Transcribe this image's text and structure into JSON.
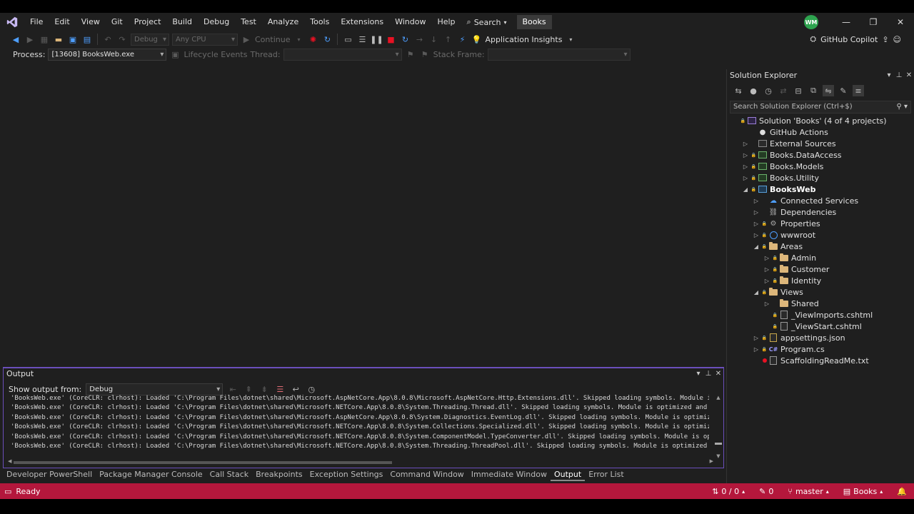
{
  "menubar": {
    "items": [
      "File",
      "Edit",
      "View",
      "Git",
      "Project",
      "Build",
      "Debug",
      "Test",
      "Analyze",
      "Tools",
      "Extensions",
      "Window",
      "Help"
    ],
    "search_label": "Search",
    "solution_name": "Books",
    "avatar_initials": "WM"
  },
  "toolbar": {
    "config_value": "Debug",
    "platform_value": "Any CPU",
    "continue_label": "Continue",
    "app_insights_label": "Application Insights",
    "github_copilot_label": "GitHub Copilot"
  },
  "toolbar2": {
    "process_label": "Process:",
    "process_value": "[13608] BooksWeb.exe",
    "lifecycle_label": "Lifecycle Events",
    "thread_label": "Thread:",
    "stack_frame_label": "Stack Frame:"
  },
  "output": {
    "title": "Output",
    "show_from_label": "Show output from:",
    "source_value": "Debug",
    "lines": [
      "'BooksWeb.exe' (CoreCLR: clrhost): Loaded 'C:\\Program Files\\dotnet\\shared\\Microsoft.AspNetCore.App\\8.0.8\\Microsoft.AspNetCore.Http.Extensions.dll'. Skipped loading symbols. Module is c",
      "'BooksWeb.exe' (CoreCLR: clrhost): Loaded 'C:\\Program Files\\dotnet\\shared\\Microsoft.NETCore.App\\8.0.8\\System.Threading.Thread.dll'. Skipped loading symbols. Module is optimized and the",
      "'BooksWeb.exe' (CoreCLR: clrhost): Loaded 'C:\\Program Files\\dotnet\\shared\\Microsoft.AspNetCore.App\\8.0.8\\System.Diagnostics.EventLog.dll'. Skipped loading symbols. Module is optimized",
      "'BooksWeb.exe' (CoreCLR: clrhost): Loaded 'C:\\Program Files\\dotnet\\shared\\Microsoft.NETCore.App\\8.0.8\\System.Collections.Specialized.dll'. Skipped loading symbols. Module is optimized",
      "'BooksWeb.exe' (CoreCLR: clrhost): Loaded 'C:\\Program Files\\dotnet\\shared\\Microsoft.NETCore.App\\8.0.8\\System.ComponentModel.TypeConverter.dll'. Skipped loading symbols. Module is optim",
      "'BooksWeb.exe' (CoreCLR: clrhost): Loaded 'C:\\Program Files\\dotnet\\shared\\Microsoft.NETCore.App\\8.0.8\\System.Threading.ThreadPool.dll'. Skipped loading symbols. Module is optimized and"
    ]
  },
  "bottom_tabs": [
    "Developer PowerShell",
    "Package Manager Console",
    "Call Stack",
    "Breakpoints",
    "Exception Settings",
    "Command Window",
    "Immediate Window",
    "Output",
    "Error List"
  ],
  "solution_explorer": {
    "title": "Solution Explorer",
    "search_placeholder": "Search Solution Explorer (Ctrl+$)",
    "tree": [
      {
        "label": "Solution 'Books' (4 of 4 projects)",
        "indent": 0,
        "arrow": "",
        "lock": true,
        "icon": "solution"
      },
      {
        "label": "GitHub Actions",
        "indent": 1,
        "arrow": "",
        "lock": false,
        "icon": "github"
      },
      {
        "label": "External Sources",
        "indent": 1,
        "arrow": "right",
        "lock": false,
        "icon": "external"
      },
      {
        "label": "Books.DataAccess",
        "indent": 1,
        "arrow": "right",
        "lock": true,
        "icon": "project-green"
      },
      {
        "label": "Books.Models",
        "indent": 1,
        "arrow": "right",
        "lock": true,
        "icon": "project-green"
      },
      {
        "label": "Books.Utility",
        "indent": 1,
        "arrow": "right",
        "lock": true,
        "icon": "project-green"
      },
      {
        "label": "BooksWeb",
        "indent": 1,
        "arrow": "down",
        "lock": true,
        "icon": "project",
        "bold": true
      },
      {
        "label": "Connected Services",
        "indent": 2,
        "arrow": "right",
        "lock": false,
        "icon": "connected"
      },
      {
        "label": "Dependencies",
        "indent": 2,
        "arrow": "right",
        "lock": false,
        "icon": "dependencies"
      },
      {
        "label": "Properties",
        "indent": 2,
        "arrow": "right",
        "lock": true,
        "icon": "properties"
      },
      {
        "label": "wwwroot",
        "indent": 2,
        "arrow": "right",
        "lock": true,
        "icon": "globe"
      },
      {
        "label": "Areas",
        "indent": 2,
        "arrow": "down",
        "lock": true,
        "icon": "folder"
      },
      {
        "label": "Admin",
        "indent": 3,
        "arrow": "right",
        "lock": true,
        "icon": "folder"
      },
      {
        "label": "Customer",
        "indent": 3,
        "arrow": "right",
        "lock": true,
        "icon": "folder"
      },
      {
        "label": "Identity",
        "indent": 3,
        "arrow": "right",
        "lock": true,
        "icon": "folder"
      },
      {
        "label": "Views",
        "indent": 2,
        "arrow": "down",
        "lock": true,
        "icon": "folder"
      },
      {
        "label": "Shared",
        "indent": 3,
        "arrow": "right",
        "lock": false,
        "icon": "folder"
      },
      {
        "label": "_ViewImports.cshtml",
        "indent": 3,
        "arrow": "",
        "lock": true,
        "icon": "file"
      },
      {
        "label": "_ViewStart.cshtml",
        "indent": 3,
        "arrow": "",
        "lock": true,
        "icon": "file"
      },
      {
        "label": "appsettings.json",
        "indent": 2,
        "arrow": "right",
        "lock": true,
        "icon": "json"
      },
      {
        "label": "Program.cs",
        "indent": 2,
        "arrow": "right",
        "lock": true,
        "icon": "cs"
      },
      {
        "label": "ScaffoldingReadMe.txt",
        "indent": 2,
        "arrow": "",
        "lock": false,
        "icon": "txt",
        "reddot": true
      }
    ]
  },
  "statusbar": {
    "ready_label": "Ready",
    "updown_count": "0 / 0",
    "pencil_count": "0",
    "branch_name": "master",
    "repo_name": "Books",
    "bg_color": "#b4173c"
  }
}
